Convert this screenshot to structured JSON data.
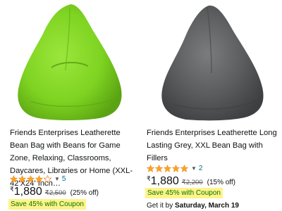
{
  "products": [
    {
      "title": "Friends Enterprises Leatherette Bean Bag with Beans for Game Zone, Relaxing, Classrooms, Daycares, Libraries or Home (XXL-42'X24' Inch…",
      "image": "lime-green-bean-bag-image",
      "image_color": "#7ed321",
      "rating_stars": 4,
      "review_count": "5",
      "currency": "₹",
      "price": "1,880",
      "mrp": "₹2,500",
      "discount": "(25% off)",
      "coupon": "Save 45% with Coupon"
    },
    {
      "title": "Friends Enterprises Leatherette Long Lasting Grey, XXL Bean Bag with Fillers",
      "image": "grey-bean-bag-image",
      "image_color": "#5a5c5e",
      "rating_stars": 5,
      "review_count": "2",
      "currency": "₹",
      "price": "1,880",
      "mrp": "₹2,200",
      "discount": "(15% off)",
      "coupon": "Save 45% with Coupon",
      "delivery_prefix": "Get it by",
      "delivery_date": "Saturday, March 19"
    }
  ],
  "colors": {
    "star": "#ffa41c",
    "link": "#007185",
    "coupon_highlight": "#fff38a",
    "coupon_text": "#007600"
  }
}
